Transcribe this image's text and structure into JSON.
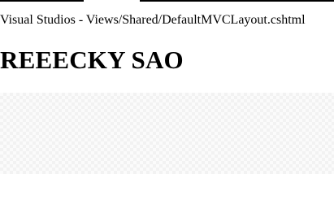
{
  "header": {
    "subtitle": "Visual Studios - Views/Shared/DefaultMVCLayout.cshtml",
    "title": "REEECKY SAO"
  },
  "colors": {
    "background": "#ffffff",
    "text": "#000000",
    "pattern_base": "#fbfbfb",
    "pattern_tile": "#f2f2f2"
  }
}
